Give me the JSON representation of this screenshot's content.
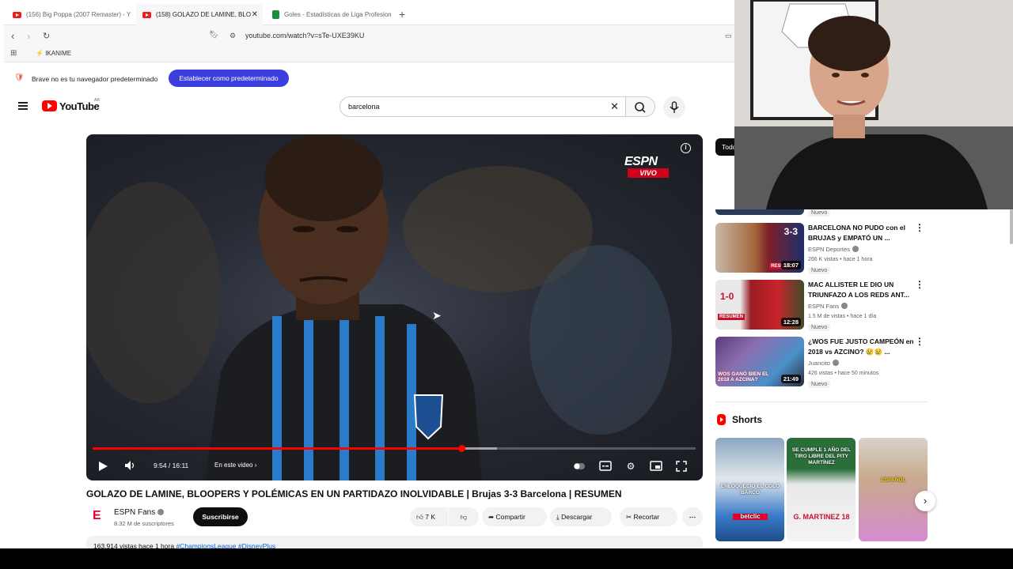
{
  "browser": {
    "tabs": [
      {
        "title": "(156) Big Poppa (2007 Remaster) - Y",
        "icon": "youtube-icon",
        "active": false
      },
      {
        "title": "(158) GOLAZO DE LAMINE, BLO",
        "icon": "youtube-icon",
        "active": true
      },
      {
        "title": "Goles - Estadísticas de Liga Profesion",
        "icon": "sheets-icon",
        "active": false
      }
    ],
    "url": "youtube.com/watch?v=sTe-UXE39KU",
    "bookmark": "IKANIME",
    "default_notice": "Brave no es tu navegador predeterminado",
    "default_button": "Establecer como predeterminado"
  },
  "header": {
    "logo_text": "YouTube",
    "country": "AR",
    "search_value": "barcelona"
  },
  "player": {
    "network": "ESPN",
    "live_label": "VIVO",
    "time_current": "9:54",
    "time_total": "16:11",
    "chapter_label": "En este video",
    "progress_played_fraction": 0.612,
    "progress_loaded_fraction": 0.67
  },
  "video": {
    "title": "GOLAZO DE LAMINE, BLOOPERS Y POLÉMICAS EN UN PARTIDAZO INOLVIDABLE | Brujas 3-3 Barcelona | RESUMEN",
    "channel": "ESPN Fans",
    "subscribers": "8.32 M de suscriptores",
    "subscribe_label": "Suscribirse",
    "likes": "7 K",
    "share_label": "Compartir",
    "download_label": "Descargar",
    "clip_label": "Recortar",
    "views_line": "163.914 vistas  hace 1 hora",
    "tags": "#ChampionsLeague #DisneyPlus"
  },
  "sidebar": {
    "chip_label": "Todos",
    "partial_badge": "Nuevo",
    "recommendations": [
      {
        "title": "BARCELONA NO PUDO con el BRUJAS y EMPATÓ UN ...",
        "channel": "ESPN Deportes",
        "meta": "266 K vistas • hace 1 hora",
        "badge": "Nuevo",
        "duration": "18:07",
        "thumb_text": "RESUMEN",
        "score": "3-3"
      },
      {
        "title": "MAC ALLISTER LE DIO UN TRIUNFAZO A LOS REDS ANT...",
        "channel": "ESPN Fans",
        "meta": "1.5 M de vistas • hace 1 día",
        "badge": "Nuevo",
        "duration": "12:28",
        "thumb_text": "RESUMEN",
        "score": "1-0"
      },
      {
        "title": "¿WOS FUE JUSTO CAMPEÓN en 2018 vs AZCINO? 😢😢 ...",
        "channel": "Juancito",
        "meta": "426 vistas • hace 50 minutos",
        "badge": "Nuevo",
        "duration": "21:49",
        "thumb_text": "WOS GANÓ BIEN EL 2018 A AZCINA?",
        "score": ""
      }
    ],
    "shorts_title": "Shorts",
    "shorts": [
      {
        "text": "ENLOQUECIÓ EL COLO BARCO",
        "brand": "betclic"
      },
      {
        "text": "SE CUMPLE 1 AÑO DEL TIRO LIBRE DEL PITY MARTÍNEZ",
        "brand": "G. MARTINEZ 18"
      },
      {
        "text": "ESPAÑOL",
        "brand": ""
      }
    ]
  },
  "colors": {
    "brand_red": "#ff0000",
    "progress_red": "#ff0000",
    "brave_button": "#3b3fde",
    "espn_red": "#d0021b"
  }
}
